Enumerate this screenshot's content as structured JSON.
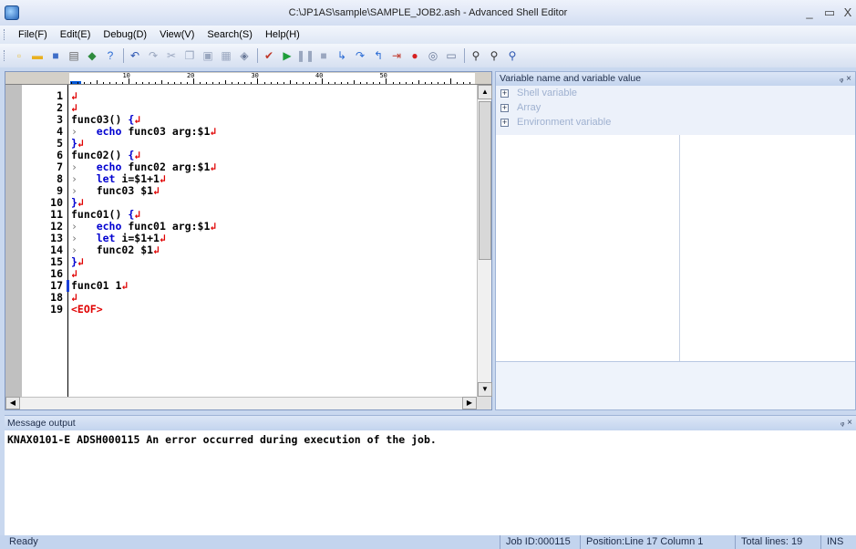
{
  "window": {
    "title": "C:\\JP1AS\\sample\\SAMPLE_JOB2.ash - Advanced Shell Editor",
    "minimize": "_",
    "maximize": "▭",
    "close": "X"
  },
  "menu": [
    "File(F)",
    "Edit(E)",
    "Debug(D)",
    "View(V)",
    "Search(S)",
    "Help(H)"
  ],
  "toolbar": {
    "icons": [
      {
        "name": "new-file-icon",
        "glyph": "▫",
        "color": "#e8c24a"
      },
      {
        "name": "open-file-icon",
        "glyph": "▬",
        "color": "#e8b020"
      },
      {
        "name": "save-icon",
        "glyph": "■",
        "color": "#3f6fc8"
      },
      {
        "name": "print-icon",
        "glyph": "▤",
        "color": "#666666"
      },
      {
        "name": "import-icon",
        "glyph": "◆",
        "color": "#2e8b3d"
      },
      {
        "name": "help-icon",
        "glyph": "?",
        "color": "#2b6cd4"
      },
      {
        "name": "sep"
      },
      {
        "name": "undo-icon",
        "glyph": "↶",
        "color": "#2b55b0"
      },
      {
        "name": "redo-icon",
        "glyph": "↷",
        "color": "#9aa7bf"
      },
      {
        "name": "cut-icon",
        "glyph": "✂",
        "color": "#9aa7bf"
      },
      {
        "name": "copy-icon",
        "glyph": "❐",
        "color": "#9aa7bf"
      },
      {
        "name": "paste-icon",
        "glyph": "▣",
        "color": "#9aa7bf"
      },
      {
        "name": "paste-special-icon",
        "glyph": "▦",
        "color": "#9aa7bf"
      },
      {
        "name": "format-icon",
        "glyph": "◈",
        "color": "#6a7a99"
      },
      {
        "name": "sep"
      },
      {
        "name": "syntax-check-icon",
        "glyph": "✔",
        "color": "#c0392b"
      },
      {
        "name": "run-icon",
        "glyph": "▶",
        "color": "#1e9e3a"
      },
      {
        "name": "pause-icon",
        "glyph": "❚❚",
        "color": "#9aa7bf"
      },
      {
        "name": "stop-icon",
        "glyph": "■",
        "color": "#9aa7bf"
      },
      {
        "name": "step-into-icon",
        "glyph": "↳",
        "color": "#2b6cd4"
      },
      {
        "name": "step-over-icon",
        "glyph": "↷",
        "color": "#2b6cd4"
      },
      {
        "name": "step-out-icon",
        "glyph": "↰",
        "color": "#2b6cd4"
      },
      {
        "name": "run-to-cursor-icon",
        "glyph": "⇥",
        "color": "#c0392b"
      },
      {
        "name": "breakpoint-icon",
        "glyph": "●",
        "color": "#d62020"
      },
      {
        "name": "clear-breakpoints-icon",
        "glyph": "◎",
        "color": "#6a7a99"
      },
      {
        "name": "watch-window-icon",
        "glyph": "▭",
        "color": "#6a7a99"
      },
      {
        "name": "sep"
      },
      {
        "name": "find-icon",
        "glyph": "⚲",
        "color": "#333333"
      },
      {
        "name": "find-next-icon",
        "glyph": "⚲",
        "color": "#333333"
      },
      {
        "name": "find-prev-icon",
        "glyph": "⚲",
        "color": "#2b55b0"
      }
    ]
  },
  "editor": {
    "ruler_labels": [
      "10",
      "20",
      "30",
      "40",
      "50"
    ],
    "lines": [
      {
        "n": "1",
        "code": ""
      },
      {
        "n": "2",
        "code": ""
      },
      {
        "n": "3",
        "code": "func03() {"
      },
      {
        "n": "4",
        "code": "\techo func03 arg:$1"
      },
      {
        "n": "5",
        "code": "}"
      },
      {
        "n": "6",
        "code": "func02() {"
      },
      {
        "n": "7",
        "code": "\techo func02 arg:$1"
      },
      {
        "n": "8",
        "code": "\tlet i=$1+1"
      },
      {
        "n": "9",
        "code": "\tfunc03 $1"
      },
      {
        "n": "10",
        "code": "}"
      },
      {
        "n": "11",
        "code": "func01() {"
      },
      {
        "n": "12",
        "code": "\techo func01 arg:$1"
      },
      {
        "n": "13",
        "code": "\tlet i=$1+1"
      },
      {
        "n": "14",
        "code": "\tfunc02 $1"
      },
      {
        "n": "15",
        "code": "}"
      },
      {
        "n": "16",
        "code": ""
      },
      {
        "n": "17",
        "code": "func01 1"
      },
      {
        "n": "18",
        "code": ""
      },
      {
        "n": "19",
        "code": "<EOF>"
      }
    ],
    "current_line": "17"
  },
  "variables": {
    "title": "Variable name and variable value",
    "pin": "ⅹ",
    "close": "x",
    "items": [
      "Shell variable",
      "Array",
      "Environment variable"
    ]
  },
  "messages": {
    "title": "Message output",
    "pin": "ⅹ",
    "close": "x",
    "text": "KNAX0101-E ADSH000115 An error occurred during execution of the job."
  },
  "status": {
    "ready": "Ready",
    "job_id": "Job ID:000115",
    "position": "Position:Line  17 Column  1",
    "total_lines": "Total lines:  19",
    "mode": "INS"
  }
}
